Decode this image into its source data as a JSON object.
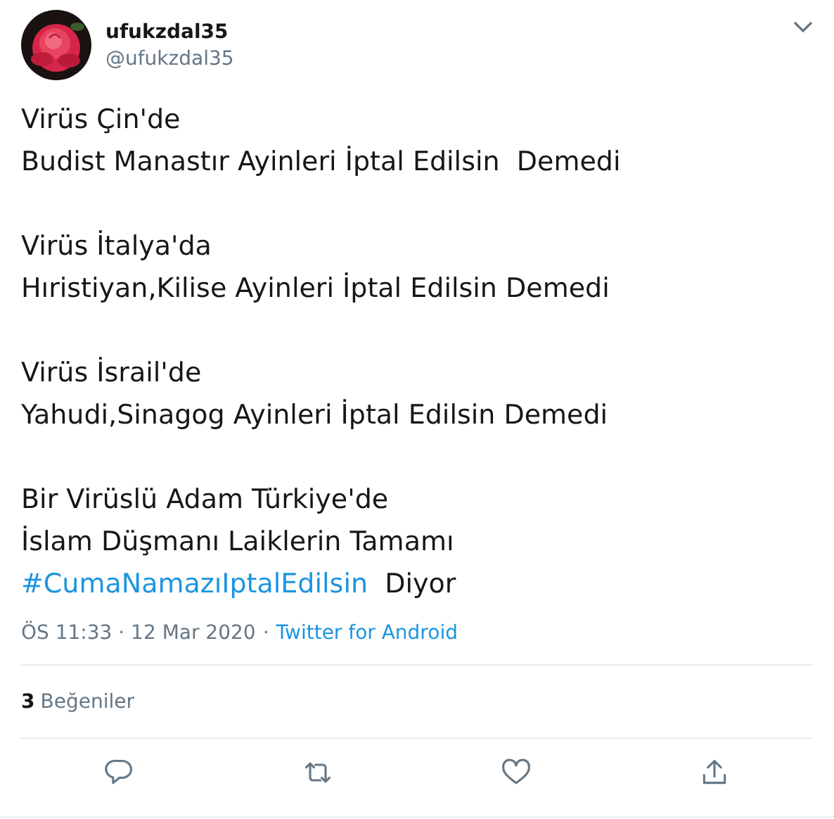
{
  "author": {
    "name": "ufukzdal35",
    "handle": "@ufukzdal35"
  },
  "paragraphs": [
    {
      "lines": [
        {
          "text": "Virüs Çin'de"
        },
        {
          "text": "Budist Manastır Ayinleri İptal Edilsin  Demedi"
        }
      ]
    },
    {
      "lines": [
        {
          "text": "Virüs İtalya'da"
        },
        {
          "text": "Hıristiyan,Kilise Ayinleri İptal Edilsin Demedi"
        }
      ]
    },
    {
      "lines": [
        {
          "text": "Virüs İsrail'de"
        },
        {
          "text": "Yahudi,Sinagog Ayinleri İptal Edilsin Demedi"
        }
      ]
    },
    {
      "lines": [
        {
          "text": "Bir Virüslü Adam Türkiye'de"
        },
        {
          "text": "İslam Düşmanı Laiklerin Tamamı"
        },
        {
          "hashtag": "#CumaNamazıIptalEdilsin",
          "text": "  Diyor"
        }
      ]
    }
  ],
  "meta": {
    "time": "ÖS 11:33 · 12 Mar 2020",
    "separator": "·",
    "source": "Twitter for Android"
  },
  "likes": {
    "count": "3",
    "label": "Beğeniler"
  }
}
